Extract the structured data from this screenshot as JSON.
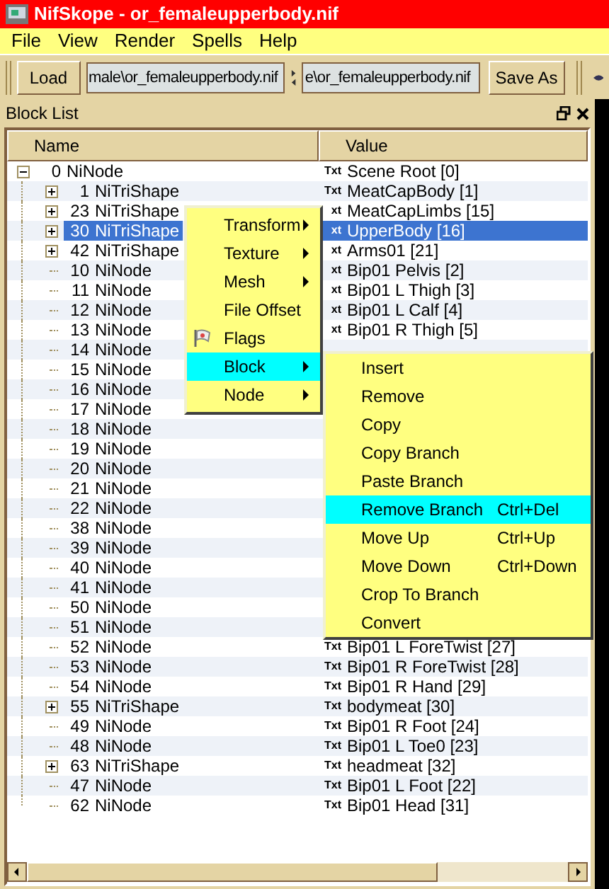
{
  "window": {
    "title": "NifSkope - or_femaleupperbody.nif"
  },
  "menu_bar": [
    "File",
    "View",
    "Render",
    "Spells",
    "Help"
  ],
  "toolbar": {
    "load_button": "Load",
    "path_field_1": "male\\or_femaleupperbody.nif",
    "path_field_2": "e\\or_femaleupperbody.nif",
    "save_button": "Save As"
  },
  "block_list": {
    "title": "Block List",
    "columns": [
      "Name",
      "Value"
    ],
    "tree": [
      {
        "index": "0",
        "type": "NiNode",
        "value_type": "Txt",
        "value": "Scene Root [0]",
        "expanded": true,
        "selected": false,
        "children": [
          {
            "index": "1",
            "type": "NiTriShape",
            "value_type": "Txt",
            "value": "MeatCapBody [1]",
            "expanded": false,
            "selected": false
          },
          {
            "index": "23",
            "type": "NiTriShape",
            "value_type": "xt",
            "value": "MeatCapLimbs [15]",
            "expanded": false,
            "selected": false
          },
          {
            "index": "30",
            "type": "NiTriShape",
            "value_type": "xt",
            "value": "UpperBody [16]",
            "expanded": false,
            "selected": true
          },
          {
            "index": "42",
            "type": "NiTriShape",
            "value_type": "xt",
            "value": "Arms01 [21]",
            "expanded": false,
            "selected": false
          },
          {
            "index": "10",
            "type": "NiNode",
            "value_type": "xt",
            "value": "Bip01 Pelvis [2]",
            "selected": false
          },
          {
            "index": "11",
            "type": "NiNode",
            "value_type": "xt",
            "value": "Bip01 L Thigh [3]",
            "selected": false
          },
          {
            "index": "12",
            "type": "NiNode",
            "value_type": "xt",
            "value": "Bip01 L Calf [4]",
            "selected": false
          },
          {
            "index": "13",
            "type": "NiNode",
            "value_type": "xt",
            "value": "Bip01 R Thigh [5]",
            "selected": false
          },
          {
            "index": "14",
            "type": "NiNode",
            "selected": false
          },
          {
            "index": "15",
            "type": "NiNode",
            "selected": false
          },
          {
            "index": "16",
            "type": "NiNode",
            "selected": false
          },
          {
            "index": "17",
            "type": "NiNode",
            "selected": false
          },
          {
            "index": "18",
            "type": "NiNode",
            "selected": false
          },
          {
            "index": "19",
            "type": "NiNode",
            "selected": false
          },
          {
            "index": "20",
            "type": "NiNode",
            "selected": false
          },
          {
            "index": "21",
            "type": "NiNode",
            "selected": false
          },
          {
            "index": "22",
            "type": "NiNode",
            "selected": false
          },
          {
            "index": "38",
            "type": "NiNode",
            "selected": false
          },
          {
            "index": "39",
            "type": "NiNode",
            "selected": false
          },
          {
            "index": "40",
            "type": "NiNode",
            "selected": false
          },
          {
            "index": "41",
            "type": "NiNode",
            "selected": false
          },
          {
            "index": "50",
            "type": "NiNode",
            "selected": false
          },
          {
            "index": "51",
            "type": "NiNode",
            "selected": false
          },
          {
            "index": "52",
            "type": "NiNode",
            "value_type": "Txt",
            "value": "Bip01 L ForeTwist [27]",
            "selected": false
          },
          {
            "index": "53",
            "type": "NiNode",
            "value_type": "Txt",
            "value": "Bip01 R ForeTwist [28]",
            "selected": false
          },
          {
            "index": "54",
            "type": "NiNode",
            "value_type": "Txt",
            "value": "Bip01 R Hand [29]",
            "selected": false
          },
          {
            "index": "55",
            "type": "NiTriShape",
            "value_type": "Txt",
            "value": "bodymeat [30]",
            "expanded": false,
            "selected": false
          },
          {
            "index": "49",
            "type": "NiNode",
            "value_type": "Txt",
            "value": "Bip01 R Foot [24]",
            "selected": false
          },
          {
            "index": "48",
            "type": "NiNode",
            "value_type": "Txt",
            "value": "Bip01 L Toe0 [23]",
            "selected": false
          },
          {
            "index": "63",
            "type": "NiTriShape",
            "value_type": "Txt",
            "value": "headmeat [32]",
            "expanded": false,
            "selected": false
          },
          {
            "index": "47",
            "type": "NiNode",
            "value_type": "Txt",
            "value": "Bip01 L Foot [22]",
            "selected": false
          },
          {
            "index": "62",
            "type": "NiNode",
            "value_type": "Txt",
            "value": "Bip01 Head [31]",
            "selected": false
          }
        ]
      }
    ]
  },
  "context_menu": {
    "items": [
      {
        "label": "Transform",
        "kind": "submenu",
        "highlighted": false
      },
      {
        "label": "Texture",
        "kind": "submenu",
        "highlighted": false
      },
      {
        "label": "Mesh",
        "kind": "submenu",
        "highlighted": false
      },
      {
        "label": "File Offset",
        "kind": "action",
        "highlighted": false
      },
      {
        "label": "Flags",
        "kind": "flag",
        "highlighted": false
      },
      {
        "label": "Block",
        "kind": "submenu",
        "highlighted": true
      },
      {
        "label": "Node",
        "kind": "submenu",
        "highlighted": false
      }
    ]
  },
  "block_submenu": {
    "items": [
      {
        "label": "Insert",
        "highlighted": false
      },
      {
        "label": "Remove",
        "highlighted": false
      },
      {
        "label": "Copy",
        "highlighted": false
      },
      {
        "label": "Copy Branch",
        "highlighted": false
      },
      {
        "label": "Paste Branch",
        "highlighted": false
      },
      {
        "label": "Remove Branch",
        "shortcut": "Ctrl+Del",
        "highlighted": true
      },
      {
        "label": "Move Up",
        "shortcut": "Ctrl+Up",
        "highlighted": false
      },
      {
        "label": "Move Down",
        "shortcut": "Ctrl+Down",
        "highlighted": false
      },
      {
        "label": "Crop To Branch",
        "highlighted": false
      },
      {
        "label": "Convert",
        "highlighted": false
      }
    ]
  }
}
